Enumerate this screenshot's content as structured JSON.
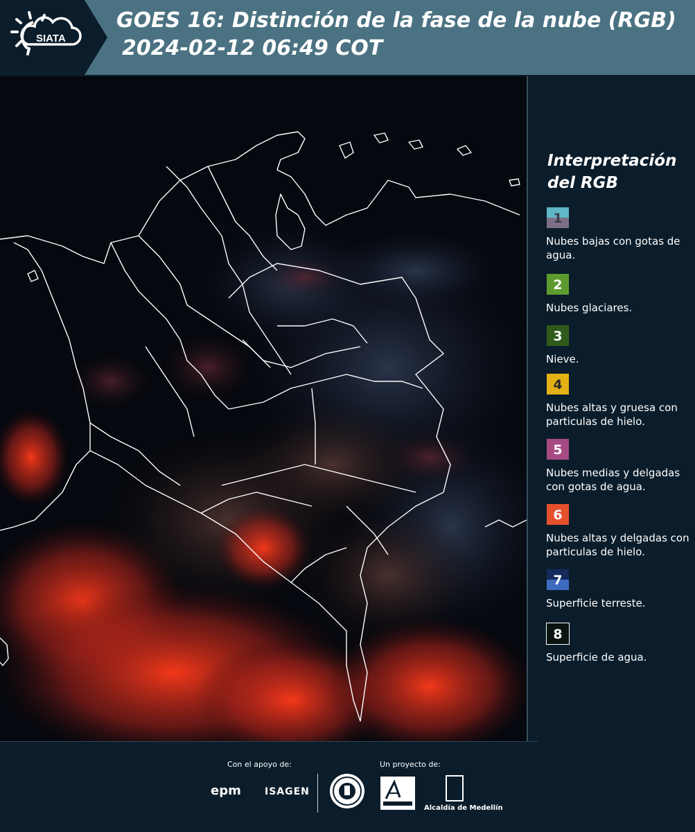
{
  "header": {
    "logo_text": "SIATA",
    "title_line1": "GOES 16: Distinción de la fase de la nube (RGB)",
    "title_line2": "2024-02-12 06:49 COT"
  },
  "legend": {
    "title_line1": "Interpretación",
    "title_line2": "del RGB",
    "items": [
      {
        "number": "1",
        "text": "Nubes bajas con gotas de agua.",
        "color_top": "#5fb7c5",
        "color_bottom": "#7d6f88",
        "number_color": "#3b3b4a"
      },
      {
        "number": "2",
        "text": "Nubes glaciares.",
        "color_top": "#5e9b2f",
        "color_bottom": "#5e9b2f",
        "number_color": "#ffffff"
      },
      {
        "number": "3",
        "text": "Nieve.",
        "color_top": "#2f5a1b",
        "color_bottom": "#2f5a1b",
        "number_color": "#ffffff"
      },
      {
        "number": "4",
        "text": "Nubes altas y gruesa con particulas de hielo.",
        "color_top": "#e3b114",
        "color_bottom": "#e3b114",
        "number_color": "#2a2a2a"
      },
      {
        "number": "5",
        "text": "Nubes medias y delgadas con gotas de agua.",
        "color_top": "#a64a84",
        "color_bottom": "#a64a84",
        "number_color": "#ffffff"
      },
      {
        "number": "6",
        "text": "Nubes altas y delgadas con particulas de hielo.",
        "color_top": "#e5502c",
        "color_bottom": "#e5502c",
        "number_color": "#ffffff"
      },
      {
        "number": "7",
        "text": "Superficie terreste.",
        "color_top": "#142a5c",
        "color_bottom": "#3e6ac0",
        "number_color": "#ffffff"
      },
      {
        "number": "8",
        "text": "Superficie de agua.",
        "color_top": "#0a1410",
        "color_bottom": "#0a1410",
        "number_color": "#ffffff",
        "border": "#ffffff"
      }
    ]
  },
  "footer": {
    "support_label": "Con el apoyo de:",
    "project_label": "Un proyecto de:",
    "epm": "epm",
    "isagen": "ISAGEN",
    "alcaldia": "Alcaldía de Medellín"
  }
}
